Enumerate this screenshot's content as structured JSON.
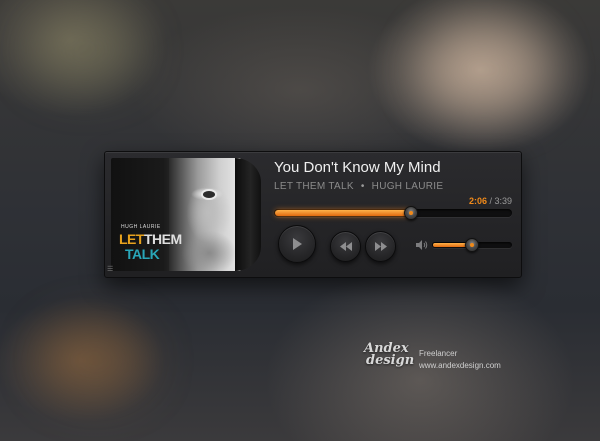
{
  "track": {
    "title": "You Don't Know My Mind",
    "album": "LET THEM TALK",
    "separator": "•",
    "artist": "HUGH LAURIE"
  },
  "cover": {
    "artist": "HUGH LAURIE",
    "title_let": "LET",
    "title_them": "THEM",
    "title_talk": "TALK"
  },
  "time": {
    "current": "2:06",
    "separator": " / ",
    "total": "3:39"
  },
  "progress": {
    "fraction": 0.575
  },
  "volume": {
    "fraction": 0.5
  },
  "colors": {
    "accent": "#f08a1a",
    "panel": "#252527",
    "title_text": "#f0f0f0",
    "sub_text": "#8b8b8b",
    "cover_let": "#e8a21d",
    "cover_talk": "#29a6b8"
  },
  "icons": {
    "play": "play-icon",
    "previous": "rewind-icon",
    "next": "fast-forward-icon",
    "volume": "speaker-icon",
    "menu": "menu-lines-icon"
  },
  "branding": {
    "logo_line1": "Andex",
    "logo_line2": "design",
    "role": "Freelancer",
    "url": "www.andexdesign.com"
  }
}
